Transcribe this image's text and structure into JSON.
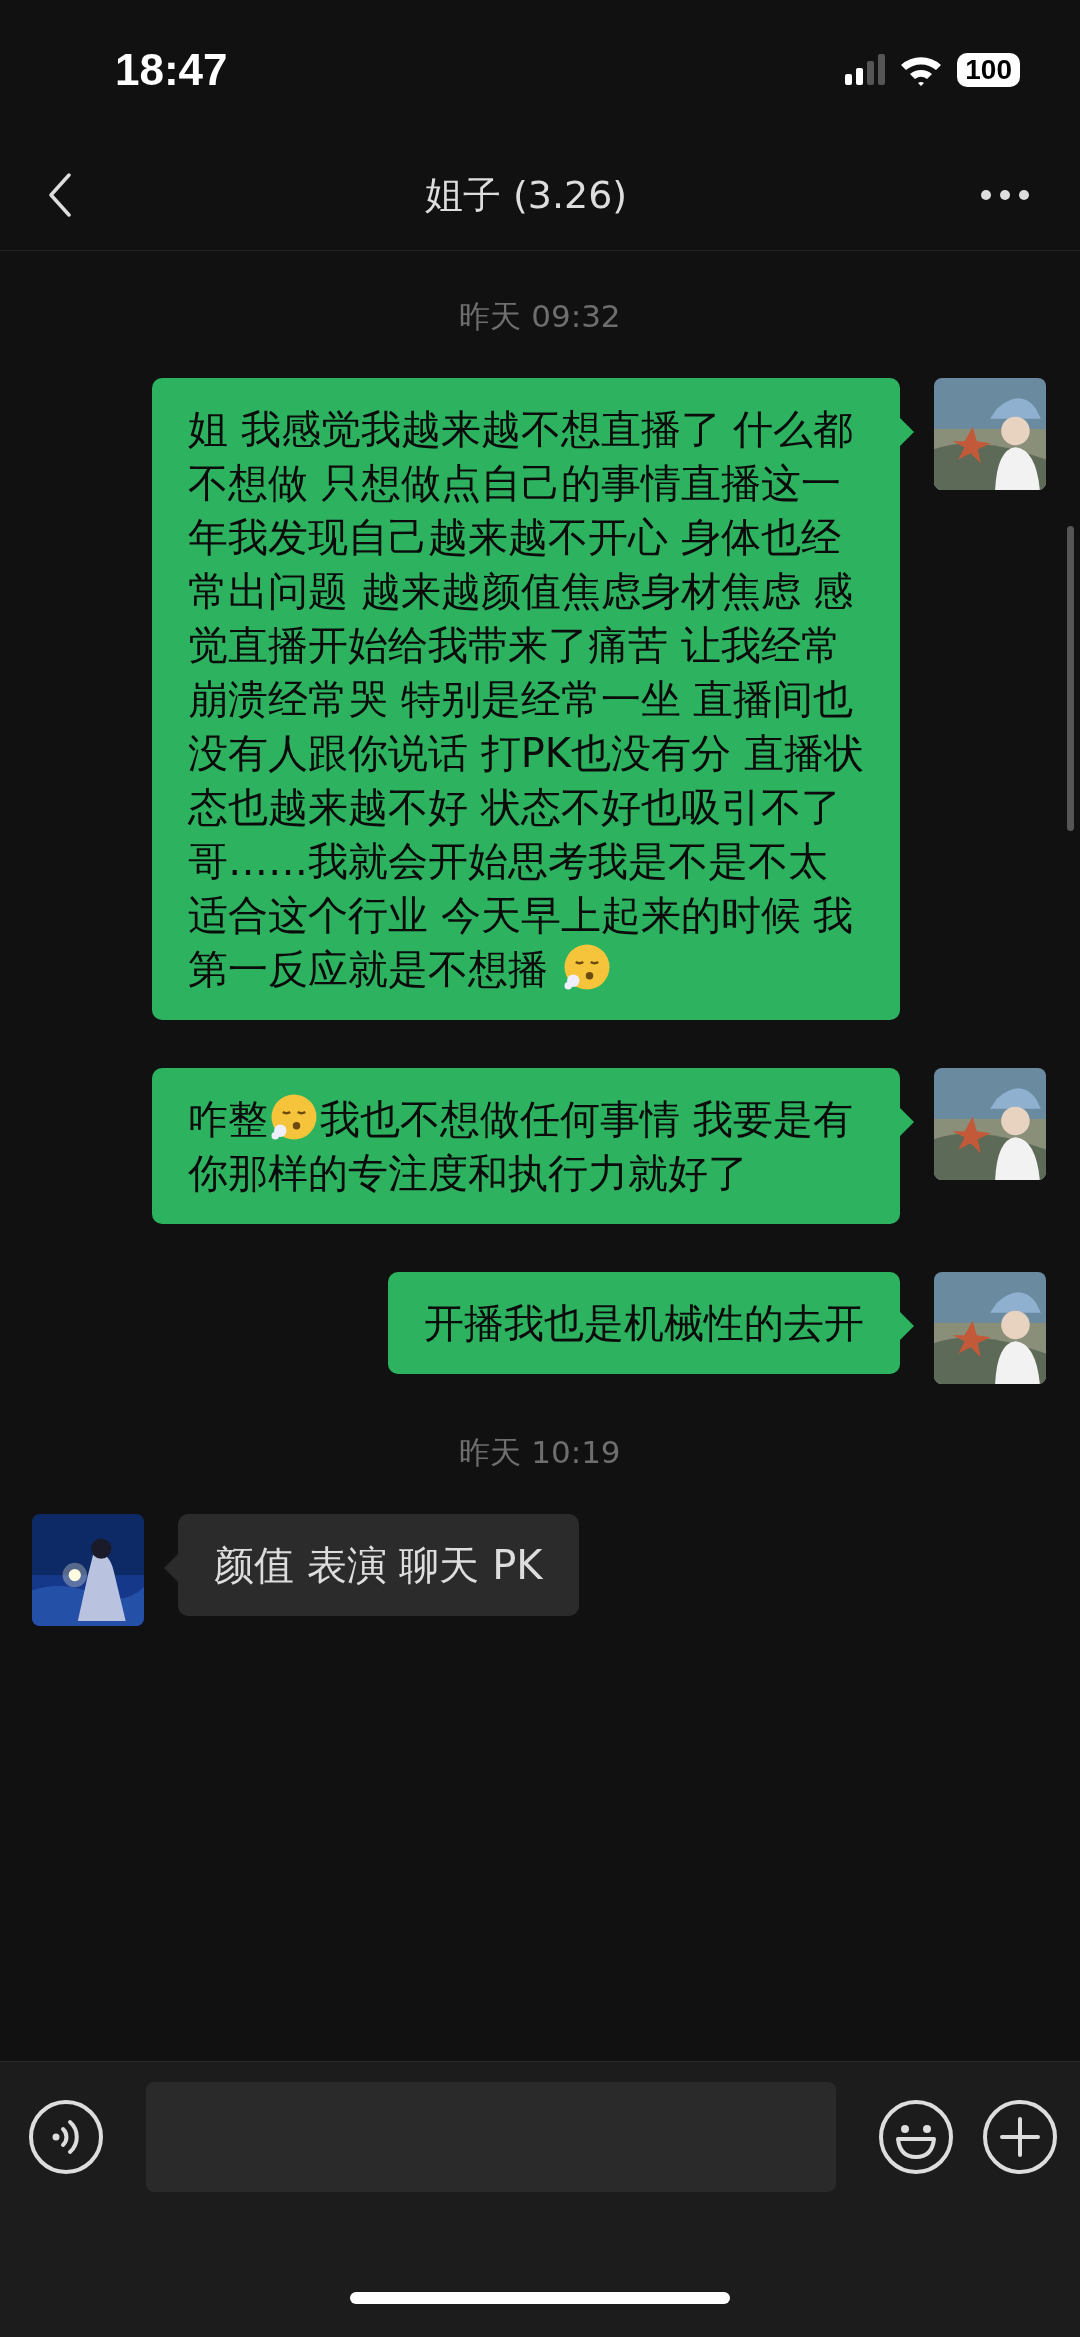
{
  "status_bar": {
    "time": "18:47",
    "battery": "100"
  },
  "nav": {
    "title": "姐子 (3.26)"
  },
  "messages": [
    {
      "kind": "time",
      "text": "昨天 09:32"
    },
    {
      "kind": "outgoing",
      "parts": [
        {
          "kind": "text",
          "text": "姐 我感觉我越来越不想直播了 什么都不想做 只想做点自己的事情直播这一年我发现自己越来越不开心 身体也经常出问题 越来越颜值焦虑身材焦虑 感觉直播开始给我带来了痛苦 让我经常崩溃经常哭 特别是经常一坐 直播间也没有人跟你说话 打PK也没有分 直播状态也越来越不好 状态不好也吸引不了哥……我就会开始思考我是不是不太适合这个行业 今天早上起来的时候 我第一反应就是不想播 "
        },
        {
          "kind": "emoji"
        }
      ]
    },
    {
      "kind": "outgoing",
      "parts": [
        {
          "kind": "text",
          "text": "咋整"
        },
        {
          "kind": "emoji"
        },
        {
          "kind": "text",
          "text": "我也不想做任何事情 我要是有你那样的专注度和执行力就好了"
        }
      ]
    },
    {
      "kind": "outgoing",
      "parts": [
        {
          "kind": "text",
          "text": "开播我也是机械性的去开"
        }
      ]
    },
    {
      "kind": "time",
      "text": "昨天 10:19"
    },
    {
      "kind": "incoming",
      "parts": [
        {
          "kind": "text",
          "text": "颜值 表演 聊天 PK"
        }
      ]
    }
  ]
}
